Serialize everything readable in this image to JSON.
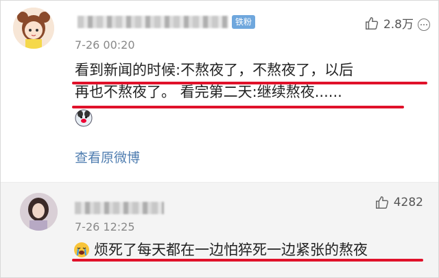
{
  "comments": [
    {
      "badge": "铁粉",
      "likes": "2.8万",
      "time": "7-26 00:20",
      "line1": "看到新闻的时候:不熬夜了，不熬夜了，以后",
      "line2": "再也不熬夜了。 看完第二天:继续熬夜......",
      "view_original": "查看原微博"
    },
    {
      "likes": "4282",
      "time": "7-26 12:25",
      "line1": "烦死了每天都在一边怕猝死一边紧张的熬夜"
    }
  ],
  "colors": {
    "underline": "#e0112a",
    "badge": "#6fa7dd",
    "link": "#4f7db0"
  },
  "icons": [
    "thumbs-up-icon",
    "more-icon",
    "dog-emoji-icon",
    "crying-emoji-icon"
  ]
}
